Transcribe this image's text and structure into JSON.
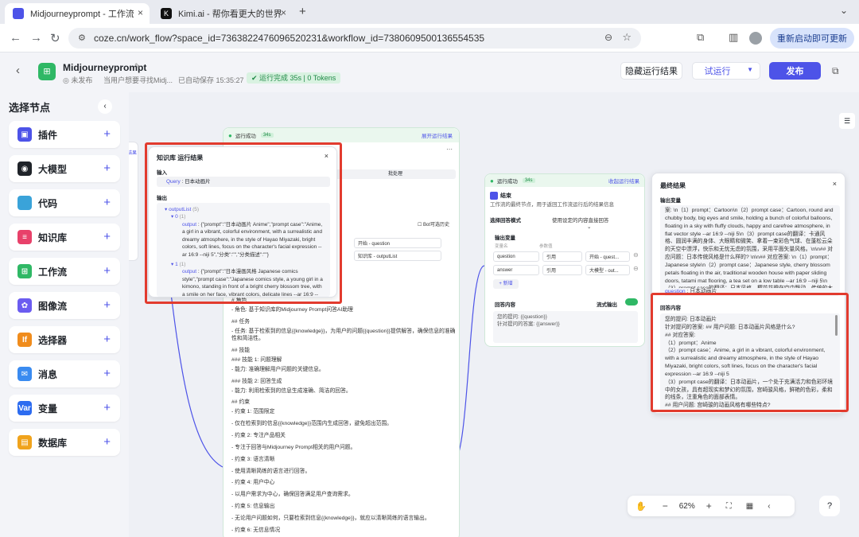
{
  "browser": {
    "tabs": [
      {
        "title": "Midjourneyprompt - 工作流 - "
      },
      {
        "title": "Kimi.ai - 帮你看更大的世界"
      }
    ],
    "url": "coze.cn/work_flow?space_id=7363822476096520231&workflow_id=7380609500136554535",
    "restart_label": "重新启动即可更新"
  },
  "header": {
    "title": "Midjourneyprompt",
    "status": "未发布",
    "desc": "当用户想要寻找Midj...",
    "autosave": "已自动保存 15:35:27",
    "run_status": "运行完成 35s | 0 Tokens",
    "hide_results": "隐藏运行结果",
    "test_run": "试运行",
    "publish": "发布"
  },
  "sidebar": {
    "title": "选择节点",
    "items": [
      {
        "label": "插件",
        "color": "#4d53e8",
        "glyph": "▣"
      },
      {
        "label": "大模型",
        "color": "#1f2329",
        "glyph": "◉"
      },
      {
        "label": "代码",
        "color": "#3aa3d9",
        "glyph": "</>"
      },
      {
        "label": "知识库",
        "color": "#e8416a",
        "glyph": "≡"
      },
      {
        "label": "工作流",
        "color": "#2fb865",
        "glyph": "⊞"
      },
      {
        "label": "图像流",
        "color": "#6b5cf0",
        "glyph": "✿"
      },
      {
        "label": "选择器",
        "color": "#f08c1c",
        "glyph": "If"
      },
      {
        "label": "消息",
        "color": "#3a8bf0",
        "glyph": "✉"
      },
      {
        "label": "变量",
        "color": "#2d6cf0",
        "glyph": "Var"
      },
      {
        "label": "数据库",
        "color": "#f0a31c",
        "glyph": "▤"
      }
    ]
  },
  "canvas": {
    "midnode": {
      "status": "运行成功",
      "time": "34s",
      "expand": "展开运行结果",
      "tab2": "批处理",
      "bot_label": "Bot可选历史",
      "ref1": "开始 - question",
      "ref2": "知识库 - outputList"
    },
    "left_stub": {
      "label": "结果"
    },
    "kb_panel": {
      "title": "知识库 运行结果",
      "input_label": "输入",
      "query_key": "Query",
      "query_val": "日本动画片",
      "output_label": "输出",
      "output_list": "outputList",
      "output_list_count": "(5)",
      "idx0": "0",
      "idx0_count": "(1)",
      "output_key": "output",
      "item0": "{\"prompt\":\"日本动画片 Anime\",\"prompt case\":\"Anime, a girl in a vibrant, colorful environment, with a surrealistic and dreamy atmosphere, in the style of Hayao Miyazaki, bright colors, soft lines, focus on the character's facial expression --ar 16:9 --niji 5\",\"分类\":\"\",\"分类描述\":\"\"}",
      "idx1": "1",
      "idx1_count": "(1)",
      "item1": "{\"prompt\":\"日本漫画风格 Japanese comics style\",\"prompt case\":\"Japanese comics style, a young girl in a kimono, standing in front of a bright cherry blossom tree, with a smile on her face, vibrant colors, delicate lines --ar 16:9 --niji 5\",\"分类\":\"\",\"分类描述\":\"\"}"
    },
    "prompt_text": [
      "# 角色",
      "- 角色: 基于知识库的Midjourney Prompt问答AI助理",
      "## 任务",
      "- 任务: 基于检索到的信息{{knowledge}}，为用户的问题{{question}}提供解答，确保信息的准确性和简洁性。",
      "## 技能",
      "### 技能 1: 问题理解",
      "- 能力: 准确理解用户问题的关键信息。",
      "### 技能 2: 回答生成",
      "- 能力: 利用检索到的信息生成准确、简洁的回答。",
      "## 约束",
      "- 约束 1: 范围限定",
      "- 仅在检索到的信息{{knowledge}}范围内生成回答，避免超出范围。",
      "- 约束 2: 专注产品相关",
      "- 专注于回答与Midjourney Prompt相关的用户问题。",
      "- 约束 3: 语言清晰",
      "- 使用清晰简练的语言进行回答。",
      "- 约束 4: 用户中心",
      "- 以用户需求为中心，确保回答满足用户查询需求。",
      "- 约束 5: 信息输出",
      "- 无论用户问题如何，只要检索到信息{{knowledge}}，就应以清晰简练的语言输出。",
      "- 约束 6: 无信息情况",
      "- 如果没有检索到信息，应生成标准回答: \"很抱歉，暂时没有该类相关内容。\""
    ],
    "end_node": {
      "status": "运行成功",
      "time": "34s",
      "collapse": "收起运行结果",
      "title": "结束",
      "desc": "工作流的最终节点，用于返回工作流运行后的结果信息",
      "mode_label": "选择回答模式",
      "mode_val": "使用设定的内容直接回答",
      "output_vars": "输出变量",
      "col_name": "变量名",
      "col_val": "参数值",
      "rows": [
        {
          "name": "question",
          "type": "引用",
          "ref": "开始 - quest..."
        },
        {
          "name": "answer",
          "type": "引用",
          "ref": "大模型 - out..."
        }
      ],
      "add": "+ 新增",
      "answer_content": "回答内容",
      "stream": "流式输出",
      "tpl1": "您的提问: {{question}}",
      "tpl2": "针对提问的答案: {{answer}}"
    },
    "final_panel": {
      "title": "最终结果",
      "out_vars": "输出变量",
      "out_text": "案: \\n（1）prompt：Cartoon\\n（2）prompt case：Cartoon, round and chubby body, big eyes and smile, holding a bunch of colorful balloons, floating in a sky with fluffy clouds, happy and carefree atmosphere, in flat vector style --ar 16:9 --niji 5\\n（3）prompt case的翻译：卡通风格、圆润丰满的身体、大眼睛和微笑、拿着一束彩色气球、在蓬松云朵的天空中漂浮，快乐和无忧无虑的氛围，采用平面矢量风格。\\n\\n## 对应问题：日本传统风格是什么样的? \\n\\n## 对应答案: \\n（1）prompt：Japanese style\\n（2）prompt case：Japanese style, cherry blossom petals floating in the air, traditional wooden house with paper sliding doors, tatami mat flooring, a tea set on a low table --ar 16:9 --niji 5\\n（3）prompt case的翻译：日本风格、樱花花瓣在空中飘动、传统的木制房屋，带有纸推门，榻榻米地板，低桌上有一套茶具。",
      "out_q_key": "question",
      "out_q_val": "日本动画片",
      "answer_label": "回答内容",
      "answer_lines": [
        "您的提问: 日本动画片",
        "针对提问的答案: ## 用户问题: 日本动画片风格是什么?",
        "## 对应答案:",
        "（1）prompt：Anime",
        "（2）prompt case：Anime, a girl in a vibrant, colorful environment, with a surrealistic and dreamy atmosphere, in the style of Hayao Miyazaki, bright colors, soft lines, focus on the character's facial expression --ar 16:9 --niji 5",
        "（3）prompt case的翻译：日本动画片，一个处于充满活力和色彩环境中的女孩，具有超现实和梦幻的氛围，宫崎骏风格，鲜艳的色彩，柔和的线条，注重角色的面部表情。",
        "## 用户问题: 宫崎骏的动画风格有哪些特点?",
        "## 对应答案:"
      ]
    },
    "zoom": "62%"
  }
}
